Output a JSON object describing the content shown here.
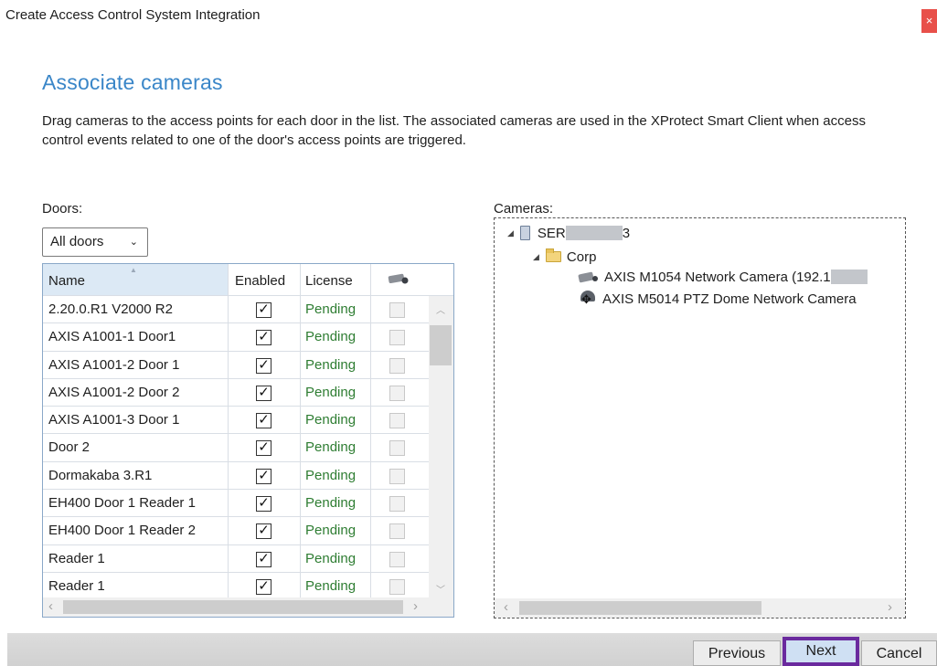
{
  "window": {
    "title": "Create Access Control System Integration",
    "close_glyph": "×"
  },
  "page": {
    "heading": "Associate cameras",
    "description": "Drag cameras to the access points for each door in the list. The associated cameras are used in the XProtect Smart Client when access control events related to one of the door's access points are triggered."
  },
  "doors": {
    "label": "Doors:",
    "filter_value": "All doors",
    "columns": {
      "name": "Name",
      "enabled": "Enabled",
      "license": "License",
      "camera_icon": "camera-icon"
    },
    "rows": [
      {
        "name": "2.20.0.R1 V2000 R2",
        "enabled": true,
        "license": "Pending"
      },
      {
        "name": "AXIS A1001-1 Door1",
        "enabled": true,
        "license": "Pending"
      },
      {
        "name": "AXIS A1001-2 Door 1",
        "enabled": true,
        "license": "Pending"
      },
      {
        "name": "AXIS A1001-2 Door 2",
        "enabled": true,
        "license": "Pending"
      },
      {
        "name": "AXIS A1001-3 Door 1",
        "enabled": true,
        "license": "Pending"
      },
      {
        "name": "Door 2",
        "enabled": true,
        "license": "Pending"
      },
      {
        "name": "Dormakaba 3.R1",
        "enabled": true,
        "license": "Pending"
      },
      {
        "name": "EH400 Door 1 Reader 1",
        "enabled": true,
        "license": "Pending"
      },
      {
        "name": "EH400 Door 1 Reader 2",
        "enabled": true,
        "license": "Pending"
      },
      {
        "name": "Reader 1",
        "enabled": true,
        "license": "Pending"
      },
      {
        "name": "Reader 1",
        "enabled": true,
        "license": "Pending"
      }
    ]
  },
  "cameras": {
    "label": "Cameras:",
    "server": {
      "name": "SER",
      "name_suffix": "3"
    },
    "folder": {
      "name": "Corp"
    },
    "items": [
      {
        "name": "AXIS M1054 Network Camera (192.1",
        "icon": "camera-icon"
      },
      {
        "name": "AXIS M5014 PTZ Dome Network Camera",
        "icon": "ptz-camera-icon"
      }
    ]
  },
  "footer": {
    "previous": "Previous",
    "next": "Next",
    "cancel": "Cancel"
  },
  "colors": {
    "heading": "#3a86c8",
    "license_text": "#2e7d32",
    "next_highlight": "#6a2a9e",
    "close_bg": "#e8504a"
  }
}
